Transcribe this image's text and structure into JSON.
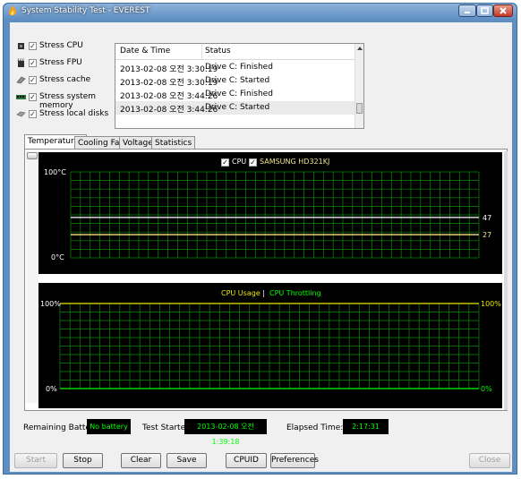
{
  "window": {
    "title": "System Stability Test - EVEREST"
  },
  "options": [
    {
      "label": "Stress CPU",
      "checked": true,
      "icon": "cpu-chip-icon"
    },
    {
      "label": "Stress FPU",
      "checked": true,
      "icon": "fpu-chip-icon"
    },
    {
      "label": "Stress cache",
      "checked": true,
      "icon": "cache-memory-icon"
    },
    {
      "label": "Stress system memory",
      "checked": true,
      "icon": "memory-module-icon"
    },
    {
      "label": "Stress local disks",
      "checked": true,
      "icon": "hard-disk-icon"
    }
  ],
  "log": {
    "columns": [
      "Date & Time",
      "Status"
    ],
    "rows": [
      [
        "2013-02-08 오전 3:30:19",
        "Drive C: Finished"
      ],
      [
        "2013-02-08 오전 3:30:19",
        "Drive C: Started"
      ],
      [
        "2013-02-08 오전 3:44:26",
        "Drive C: Finished"
      ],
      [
        "2013-02-08 오전 3:44:26",
        "Drive C: Started"
      ]
    ]
  },
  "tabs": [
    "Temperatures",
    "Cooling Fans",
    "Voltages",
    "Statistics"
  ],
  "active_tab": "Temperatures",
  "temp_chart": {
    "legend": [
      {
        "label": "CPU",
        "checked": true,
        "color": "#ffffff"
      },
      {
        "label": "SAMSUNG HD321KJ",
        "checked": true,
        "color": "#f0e68c"
      }
    ],
    "y_top": "100°C",
    "y_bottom": "0°C",
    "right_labels": [
      "47",
      "27"
    ]
  },
  "usage_chart": {
    "legend_a": "CPU Usage",
    "legend_sep": "|",
    "legend_b": "CPU Throttling",
    "left_top": "100%",
    "left_bottom": "0%",
    "right_top": "100%",
    "right_bottom": "0%"
  },
  "status": {
    "battery_label": "Remaining Battery:",
    "battery_value": "No battery",
    "started_label": "Test Started:",
    "started_value": "2013-02-08 오전 1:39:18",
    "elapsed_label": "Elapsed Time:",
    "elapsed_value": "2:17:31"
  },
  "buttons": {
    "start": "Start",
    "stop": "Stop",
    "clear": "Clear",
    "save": "Save",
    "cpuid": "CPUID",
    "preferences": "Preferences",
    "close": "Close"
  },
  "chart_data": [
    {
      "type": "line",
      "x": [
        0,
        1
      ],
      "series": [
        {
          "name": "CPU",
          "values": [
            47,
            47
          ]
        },
        {
          "name": "SAMSUNG HD321KJ",
          "values": [
            27,
            27
          ]
        }
      ],
      "ylim": [
        0,
        100
      ],
      "grid": true,
      "legend_placement": "top-center"
    },
    {
      "type": "line",
      "x": [
        0,
        1
      ],
      "series": [
        {
          "name": "CPU Usage",
          "values": [
            100,
            100
          ]
        },
        {
          "name": "CPU Throttling",
          "values": [
            0,
            0
          ]
        }
      ],
      "ylim": [
        0,
        100
      ],
      "grid": true,
      "legend_placement": "top-center"
    }
  ],
  "colors": {
    "grid": "#0a8a0a",
    "cpu_usage": "#e8e800",
    "cpu_throttling": "#00ff00",
    "temp_cpu": "#ffffff",
    "temp_disk": "#f0e68c"
  }
}
